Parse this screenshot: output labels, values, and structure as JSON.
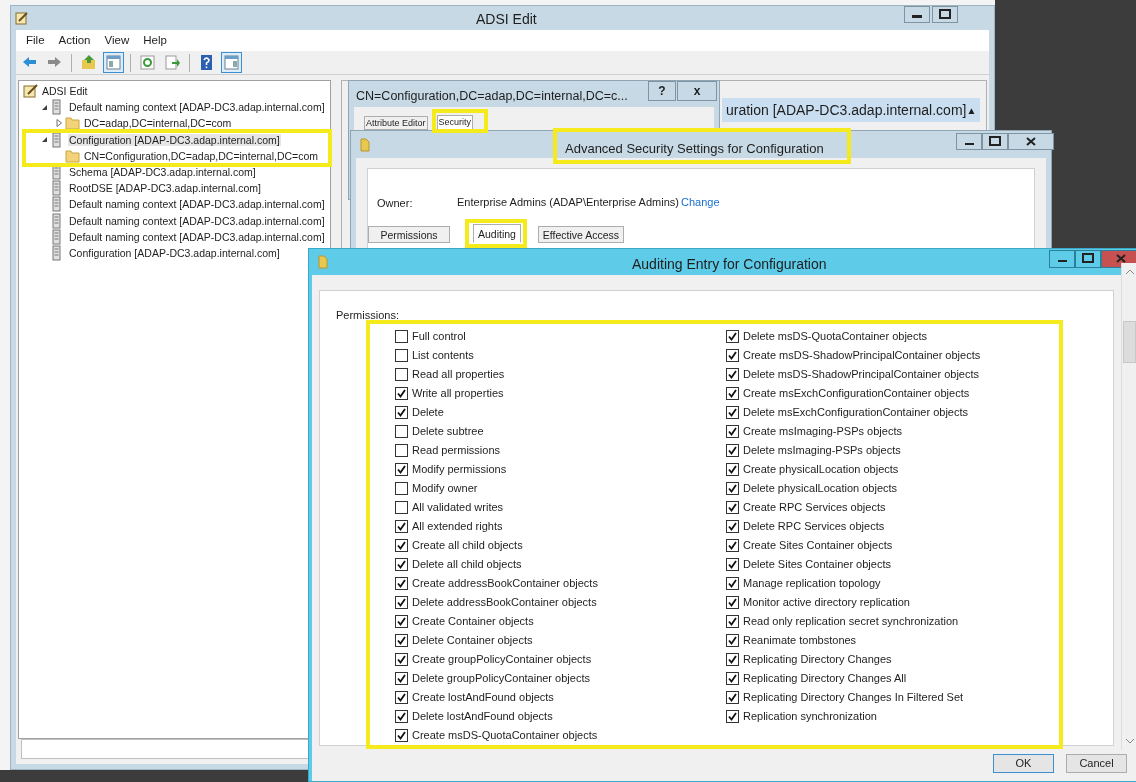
{
  "main_window": {
    "title": "ADSI Edit",
    "menu": [
      "File",
      "Action",
      "View",
      "Help"
    ],
    "toolbar": [
      [
        {
          "kind": "back",
          "pressed": false
        },
        {
          "kind": "forward",
          "pressed": false
        }
      ],
      [
        {
          "kind": "up",
          "pressed": false
        },
        {
          "kind": "console-tree",
          "pressed": true
        }
      ],
      [
        {
          "kind": "refresh",
          "pressed": false
        },
        {
          "kind": "export",
          "pressed": false
        }
      ],
      [
        {
          "kind": "help",
          "pressed": false
        },
        {
          "kind": "action-pane",
          "pressed": true
        }
      ]
    ],
    "tree": [
      {
        "label": "ADSI Edit",
        "selected": false,
        "children": [
          {
            "label": "Default naming context [ADAP-DC3.adap.internal.com]",
            "expanded": true,
            "selected": false,
            "children": [
              {
                "label": "DC=adap,DC=internal,DC=com",
                "expanded": false,
                "selected": false
              }
            ]
          },
          {
            "label": "Configuration [ADAP-DC3.adap.internal.com]",
            "expanded": true,
            "selected": true,
            "children": [
              {
                "label": "CN=Configuration,DC=adap,DC=internal,DC=com",
                "selected": false
              }
            ]
          },
          {
            "label": "Schema [ADAP-DC3.adap.internal.com]",
            "selected": false
          },
          {
            "label": "RootDSE [ADAP-DC3.adap.internal.com]",
            "selected": false
          },
          {
            "label": "Default naming context [ADAP-DC3.adap.internal.com]",
            "selected": false
          },
          {
            "label": "Default naming context [ADAP-DC3.adap.internal.com]",
            "selected": false
          },
          {
            "label": "Default naming context [ADAP-DC3.adap.internal.com]",
            "selected": false
          },
          {
            "label": "Configuration [ADAP-DC3.adap.internal.com]",
            "selected": false
          }
        ]
      }
    ],
    "list_row": {
      "text": "uration [ADAP-DC3.adap.internal.com]",
      "arrow": "▲"
    }
  },
  "properties_dialog": {
    "title": "CN=Configuration,DC=adap,DC=internal,DC=c...",
    "help_button": "?",
    "close_button": "x",
    "tabs": [
      {
        "label": "Attribute Editor",
        "selected": false
      },
      {
        "label": "Security",
        "selected": true
      }
    ]
  },
  "advanced_security": {
    "title": "Advanced Security Settings for Configuration",
    "owner_label": "Owner:",
    "owner": "Enterprise Admins (ADAP\\Enterprise Admins)",
    "change_link": "Change",
    "tabs": [
      {
        "label": "Permissions",
        "selected": false
      },
      {
        "label": "Auditing",
        "selected": true
      },
      {
        "label": "Effective Access",
        "selected": false
      }
    ]
  },
  "auditing_entry": {
    "title": "Auditing Entry for Configuration",
    "permissions_label": "Permissions:",
    "permissions_left": [
      {
        "label": "Full control",
        "checked": false
      },
      {
        "label": "List contents",
        "checked": false
      },
      {
        "label": "Read all properties",
        "checked": false
      },
      {
        "label": "Write all properties",
        "checked": true
      },
      {
        "label": "Delete",
        "checked": true
      },
      {
        "label": "Delete subtree",
        "checked": false
      },
      {
        "label": "Read permissions",
        "checked": false
      },
      {
        "label": "Modify permissions",
        "checked": true
      },
      {
        "label": "Modify owner",
        "checked": false
      },
      {
        "label": "All validated writes",
        "checked": false
      },
      {
        "label": "All extended rights",
        "checked": true
      },
      {
        "label": "Create all child objects",
        "checked": true
      },
      {
        "label": "Delete all child objects",
        "checked": true
      },
      {
        "label": "Create addressBookContainer objects",
        "checked": true
      },
      {
        "label": "Delete addressBookContainer objects",
        "checked": true
      },
      {
        "label": "Create Container objects",
        "checked": true
      },
      {
        "label": "Delete Container objects",
        "checked": true
      },
      {
        "label": "Create groupPolicyContainer objects",
        "checked": true
      },
      {
        "label": "Delete groupPolicyContainer objects",
        "checked": true
      },
      {
        "label": "Create lostAndFound objects",
        "checked": true
      },
      {
        "label": "Delete lostAndFound objects",
        "checked": true
      },
      {
        "label": "Create msDS-QuotaContainer objects",
        "checked": true
      }
    ],
    "permissions_right": [
      {
        "label": "Delete msDS-QuotaContainer objects",
        "checked": true
      },
      {
        "label": "Create msDS-ShadowPrincipalContainer objects",
        "checked": true
      },
      {
        "label": "Delete msDS-ShadowPrincipalContainer objects",
        "checked": true
      },
      {
        "label": "Create msExchConfigurationContainer objects",
        "checked": true
      },
      {
        "label": "Delete msExchConfigurationContainer objects",
        "checked": true
      },
      {
        "label": "Create msImaging-PSPs objects",
        "checked": true
      },
      {
        "label": "Delete msImaging-PSPs objects",
        "checked": true
      },
      {
        "label": "Create physicalLocation objects",
        "checked": true
      },
      {
        "label": "Delete physicalLocation objects",
        "checked": true
      },
      {
        "label": "Create RPC Services objects",
        "checked": true
      },
      {
        "label": "Delete RPC Services objects",
        "checked": true
      },
      {
        "label": "Create Sites Container objects",
        "checked": true
      },
      {
        "label": "Delete Sites Container objects",
        "checked": true
      },
      {
        "label": "Manage replication topology",
        "checked": true
      },
      {
        "label": "Monitor active directory replication",
        "checked": true
      },
      {
        "label": "Read only replication secret synchronization",
        "checked": true
      },
      {
        "label": "Reanimate tombstones",
        "checked": true
      },
      {
        "label": "Replicating Directory Changes",
        "checked": true
      },
      {
        "label": "Replicating Directory Changes All",
        "checked": true
      },
      {
        "label": "Replicating Directory Changes In Filtered Set",
        "checked": true
      },
      {
        "label": "Replication synchronization",
        "checked": true
      }
    ],
    "buttons": [
      "OK",
      "Cancel"
    ]
  }
}
